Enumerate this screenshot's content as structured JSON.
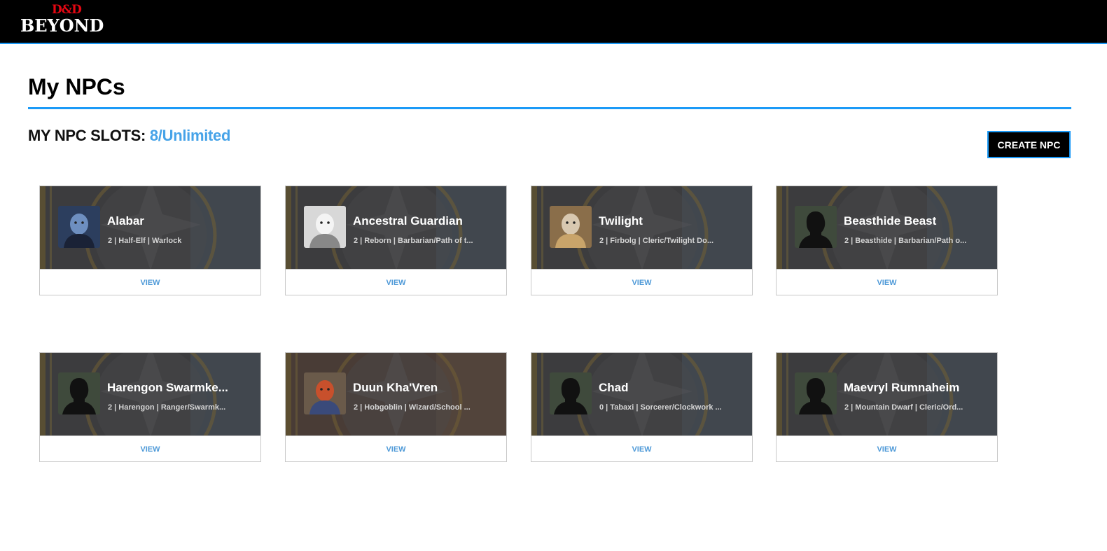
{
  "header": {
    "logo_top": "D&D",
    "logo_bottom": "BEYOND"
  },
  "page": {
    "title": "My NPCs"
  },
  "slots": {
    "label": "MY NPC SLOTS:",
    "value": "8/Unlimited"
  },
  "actions": {
    "create_label": "CREATE NPC"
  },
  "npcs": [
    {
      "name": "Alabar",
      "meta": "2 | Half-Elf | Warlock",
      "view": "VIEW",
      "avatar": "portrait-blue"
    },
    {
      "name": "Ancestral Guardian",
      "meta": "2 | Reborn | Barbarian/Path of t...",
      "view": "VIEW",
      "avatar": "portrait-white"
    },
    {
      "name": "Twilight",
      "meta": "2 | Firbolg | Cleric/Twilight Do...",
      "view": "VIEW",
      "avatar": "portrait-firbolg"
    },
    {
      "name": "Beasthide Beast",
      "meta": "2 | Beasthide | Barbarian/Path o...",
      "view": "VIEW",
      "avatar": "silhouette"
    },
    {
      "name": "Harengon Swarmke...",
      "meta": "2 | Harengon | Ranger/Swarmk...",
      "view": "VIEW",
      "avatar": "silhouette"
    },
    {
      "name": "Duun Kha'Vren",
      "meta": "2 | Hobgoblin | Wizard/School ...",
      "view": "VIEW",
      "avatar": "portrait-hobgoblin"
    },
    {
      "name": "Chad",
      "meta": "0 | Tabaxi | Sorcerer/Clockwork ...",
      "view": "VIEW",
      "avatar": "silhouette"
    },
    {
      "name": "Maevryl Rumnaheim",
      "meta": "2 | Mountain Dwarf | Cleric/Ord...",
      "view": "VIEW",
      "avatar": "silhouette"
    }
  ]
}
